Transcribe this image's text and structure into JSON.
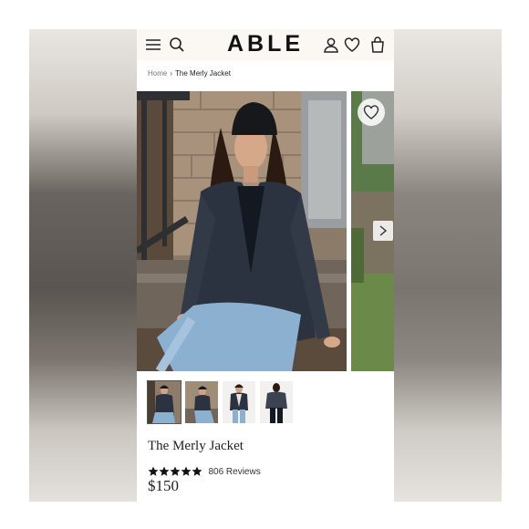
{
  "header": {
    "logo": "ABLE",
    "icons": [
      "menu-icon",
      "search-icon",
      "account-icon",
      "heart-icon",
      "bag-icon"
    ]
  },
  "breadcrumb": {
    "home": "Home",
    "separator": "›",
    "current": "The Merly Jacket"
  },
  "gallery": {
    "images": [
      "model-seated-steps",
      "model-seated-steps-alt",
      "model-front-view",
      "model-back-view"
    ],
    "thumbnails": 4,
    "active_index": 0,
    "icons": [
      "heart-icon",
      "chevron-right-icon"
    ]
  },
  "product": {
    "title": "The Merly Jacket",
    "rating_stars": 5,
    "reviews": "806 Reviews",
    "price": "$150"
  },
  "colors": {
    "header_bg": "#fbf8f3",
    "text": "#222222",
    "star": "#111111"
  }
}
